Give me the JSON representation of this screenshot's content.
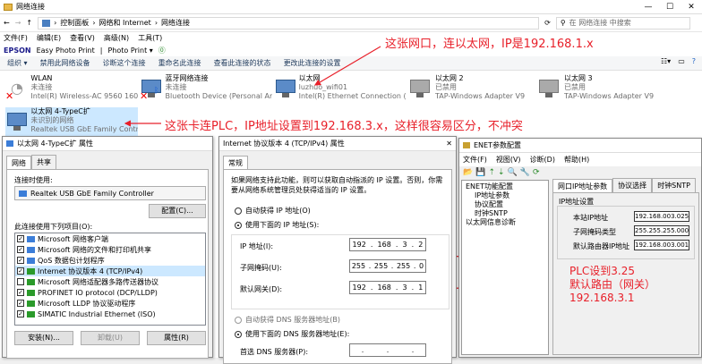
{
  "window": {
    "title": "网络连接",
    "controls": [
      "—",
      "☐",
      "✕"
    ]
  },
  "address": {
    "path": [
      "控制面板",
      "网络和 Internet",
      "网络连接"
    ],
    "search_placeholder": "在 网络连接 中搜索"
  },
  "menu": [
    "文件(F)",
    "编辑(E)",
    "查看(V)",
    "高级(N)",
    "工具(T)"
  ],
  "epson": {
    "brand": "EPSON",
    "label": "Easy Photo Print",
    "info": "Photo Print ▾"
  },
  "cmd": [
    "组织 ▾",
    "禁用此网络设备",
    "诊断这个连接",
    "重命名此连接",
    "查看此连接的状态",
    "更改此连接的设置"
  ],
  "adapters": [
    {
      "name": "WLAN",
      "status": "未连接",
      "device": "Intel(R) Wireless-AC 9560 160..."
    },
    {
      "name": "蓝牙网络连接",
      "status": "未连接",
      "device": "Bluetooth Device (Personal Ar..."
    },
    {
      "name": "以太网",
      "status": "luzhuo_wifi01",
      "device": "Intel(R) Ethernet Connection (7..."
    },
    {
      "name": "以太网 2",
      "status": "已禁用",
      "device": "TAP-Windows Adapter V9"
    },
    {
      "name": "以太网 3",
      "status": "已禁用",
      "device": "TAP-Windows Adapter V9"
    },
    {
      "name": "以太网 4-TypeC扩",
      "status": "未识别的网络",
      "device": "Realtek USB GbE Family Contr..."
    }
  ],
  "annotations": {
    "top": "这张网口，连以太网，IP是192.168.1.x",
    "mid": "这张卡连PLC，IP地址设置到192.168.3.x，这样很容易区分，不冲突",
    "plc": [
      "PLC设到3.25",
      "默认路由（网关）",
      "192.168.3.1"
    ]
  },
  "props": {
    "title": "以太网 4-TypeC扩 属性",
    "tabs": [
      "网络",
      "共享"
    ],
    "connect_using": "连接时使用:",
    "adapter": "Realtek USB GbE Family Controller",
    "configure": "配置(C)...",
    "items_label": "此连接使用下列项目(O):",
    "items": [
      {
        "label": "Microsoft 网络客户端",
        "checked": "✓"
      },
      {
        "label": "Microsoft 网络的文件和打印机共享",
        "checked": "✓"
      },
      {
        "label": "QoS 数据包计划程序",
        "checked": "✓"
      },
      {
        "label": "Internet 协议版本 4 (TCP/IPv4)",
        "checked": "✓"
      },
      {
        "label": "Microsoft 网络适配器多路传送器协议",
        "checked": ""
      },
      {
        "label": "PROFINET IO protocol (DCP/LLDP)",
        "checked": "✓"
      },
      {
        "label": "Microsoft LLDP 协议驱动程序",
        "checked": "✓"
      },
      {
        "label": "SIMATIC Industrial Ethernet (ISO)",
        "checked": "✓"
      }
    ],
    "install": "安装(N)...",
    "uninstall": "卸载(U)",
    "properties": "属性(R)"
  },
  "ipv4": {
    "title": "Internet 协议版本 4 (TCP/IPv4) 属性",
    "tab": "常规",
    "desc": "如果网络支持此功能，则可以获取自动指派的 IP 设置。否则，你需要从网络系统管理员处获得适当的 IP 设置。",
    "auto_ip": "自动获得 IP 地址(O)",
    "manual_ip": "使用下面的 IP 地址(S):",
    "ip_label": "IP 地址(I):",
    "ip": [
      "192",
      ".",
      "168",
      ".",
      "3",
      ".",
      "2"
    ],
    "mask_label": "子网掩码(U):",
    "mask": [
      "255",
      ".",
      "255",
      ".",
      "255",
      ".",
      "0"
    ],
    "gw_label": "默认网关(D):",
    "gw": [
      "192",
      ".",
      "168",
      ".",
      "3",
      ".",
      "1"
    ],
    "auto_dns": "自动获得 DNS 服务器地址(B)",
    "manual_dns": "使用下面的 DNS 服务器地址(E):",
    "dns_label": "首选 DNS 服务器(P):",
    "dns": [
      ".",
      ".",
      "."
    ]
  },
  "enet": {
    "title": "ENET参数配置",
    "menu": [
      "文件(F)",
      "视图(V)",
      "诊断(D)",
      "帮助(H)"
    ],
    "tree": [
      "ENET功能配置",
      "IP地址参数",
      "协议配置",
      "时钟SNTP",
      "以太网信息诊断"
    ],
    "tabs": [
      "网口IP地址参数",
      "协议选择",
      "时钟SNTP"
    ],
    "group": "IP地址设置",
    "local_ip_label": "本站IP地址",
    "local_ip": "192.168.003.025",
    "mask_label": "子网掩码类型",
    "mask": "255.255.255.000",
    "gw_label": "默认路由器IP地址",
    "gw": "192.168.003.001"
  }
}
